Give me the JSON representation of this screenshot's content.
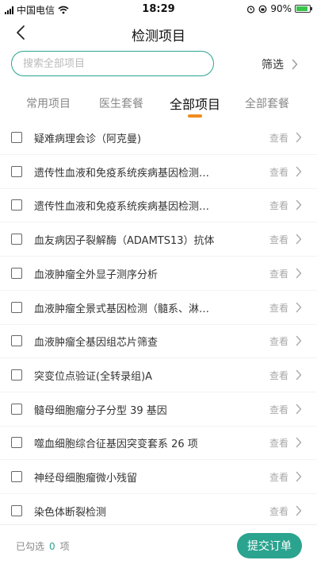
{
  "status_bar": {
    "carrier": "中国电信",
    "time": "18:29",
    "battery_percent": "90%",
    "battery_level": 0.9,
    "icons": [
      "signal-icon",
      "wifi-icon",
      "alarm-icon",
      "rotation-lock-icon",
      "battery-icon"
    ]
  },
  "header": {
    "title": "检测项目",
    "back_icon": "chevron-left-icon"
  },
  "search": {
    "placeholder": "搜索全部项目",
    "value": ""
  },
  "filter": {
    "label": "筛选",
    "icon": "chevron-right-icon"
  },
  "tabs": [
    {
      "label": "常用项目",
      "active": false
    },
    {
      "label": "医生套餐",
      "active": false
    },
    {
      "label": "全部项目",
      "active": true
    },
    {
      "label": "全部套餐",
      "active": false
    }
  ],
  "colors": {
    "accent": "#2aa38f",
    "tab_indicator": "#ef8c1f"
  },
  "items": [
    {
      "name": "疑难病理会诊（阿克曼)",
      "action": "查看",
      "checked": false
    },
    {
      "name": "遗传性血液和免疫系统疾病基因检测…",
      "action": "查看",
      "checked": false
    },
    {
      "name": "遗传性血液和免疫系统疾病基因检测…",
      "action": "查看",
      "checked": false
    },
    {
      "name": "血友病因子裂解酶（ADAMTS13）抗体",
      "action": "查看",
      "checked": false
    },
    {
      "name": "血液肿瘤全外显子测序分析",
      "action": "查看",
      "checked": false
    },
    {
      "name": "血液肿瘤全景式基因检测（髓系、淋…",
      "action": "查看",
      "checked": false
    },
    {
      "name": "血液肿瘤全基因组芯片筛查",
      "action": "查看",
      "checked": false
    },
    {
      "name": "突变位点验证(全转录组)A",
      "action": "查看",
      "checked": false
    },
    {
      "name": "髓母细胞瘤分子分型 39 基因",
      "action": "查看",
      "checked": false
    },
    {
      "name": "噬血细胞综合征基因突变套系 26 项",
      "action": "查看",
      "checked": false
    },
    {
      "name": "神经母细胞瘤微小残留",
      "action": "查看",
      "checked": false
    },
    {
      "name": "染色体断裂检测",
      "action": "查看",
      "checked": false
    }
  ],
  "footer": {
    "selected_prefix": "已勾选",
    "selected_count": "0",
    "selected_suffix": "项",
    "submit_label": "提交订单"
  }
}
